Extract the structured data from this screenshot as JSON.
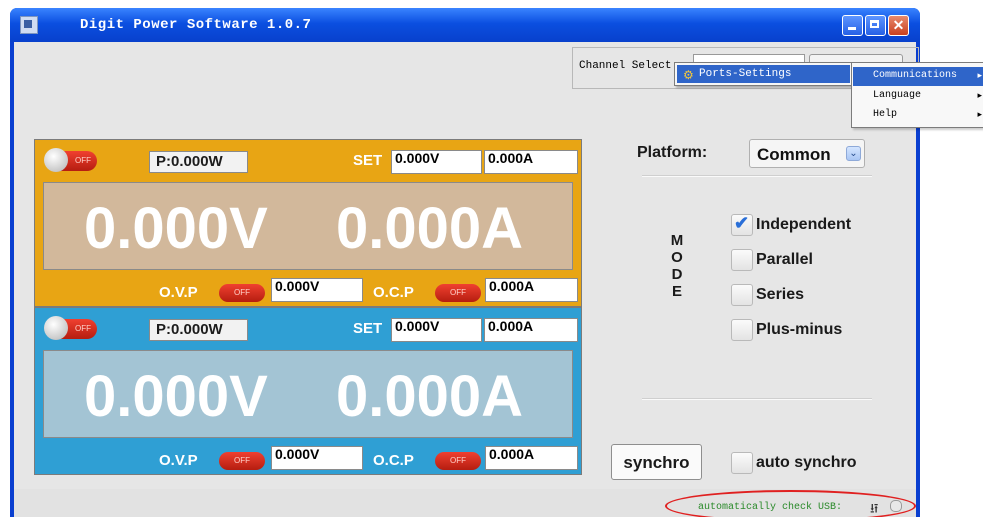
{
  "window": {
    "title": "Digit Power Software 1.0.7",
    "close_glyph": "✕"
  },
  "toolbar": {
    "channel_select_label": "Channel Select:"
  },
  "channel1": {
    "power": "P:0.000W",
    "set_label": "SET",
    "set_voltage": "0.000V",
    "set_current": "0.000A",
    "voltage": "0.000V",
    "current": "0.000A",
    "ovp_label": "O.V.P",
    "ovp_value": "0.000V",
    "ocp_label": "O.C.P",
    "ocp_value": "0.000A",
    "switch_state": "OFF",
    "color": "#e8a514"
  },
  "channel2": {
    "power": "P:0.000W",
    "set_label": "SET",
    "set_voltage": "0.000V",
    "set_current": "0.000A",
    "voltage": "0.000V",
    "current": "0.000A",
    "ovp_label": "O.V.P",
    "ovp_value": "0.000V",
    "ocp_label": "O.C.P",
    "ocp_value": "0.000A",
    "switch_state": "OFF",
    "color": "#2f9fd4"
  },
  "platform": {
    "label": "Platform:",
    "value": "Common",
    "arrow_glyph": "⌄"
  },
  "mode": {
    "letters": [
      "M",
      "O",
      "D",
      "E"
    ],
    "options": [
      {
        "label": "Independent",
        "checked": true
      },
      {
        "label": "Parallel",
        "checked": false
      },
      {
        "label": "Series",
        "checked": false
      },
      {
        "label": "Plus-minus",
        "checked": false
      }
    ],
    "check_glyph": "✔"
  },
  "sync": {
    "button_label": "synchro",
    "auto_label": "auto synchro",
    "auto_checked": false
  },
  "status": {
    "text": "automatically check USB:",
    "usb_icon": "usb-icon",
    "usb_glyph": "⭿",
    "highlight_color": "#e02020"
  },
  "menu": {
    "popup_item": "Ports-Settings",
    "popup_icon": "⚙",
    "submenu_arrow": "▸",
    "submenu": [
      {
        "label": "Communications",
        "selected": true
      },
      {
        "label": "Language",
        "selected": false
      },
      {
        "label": "Help",
        "selected": false
      }
    ]
  }
}
